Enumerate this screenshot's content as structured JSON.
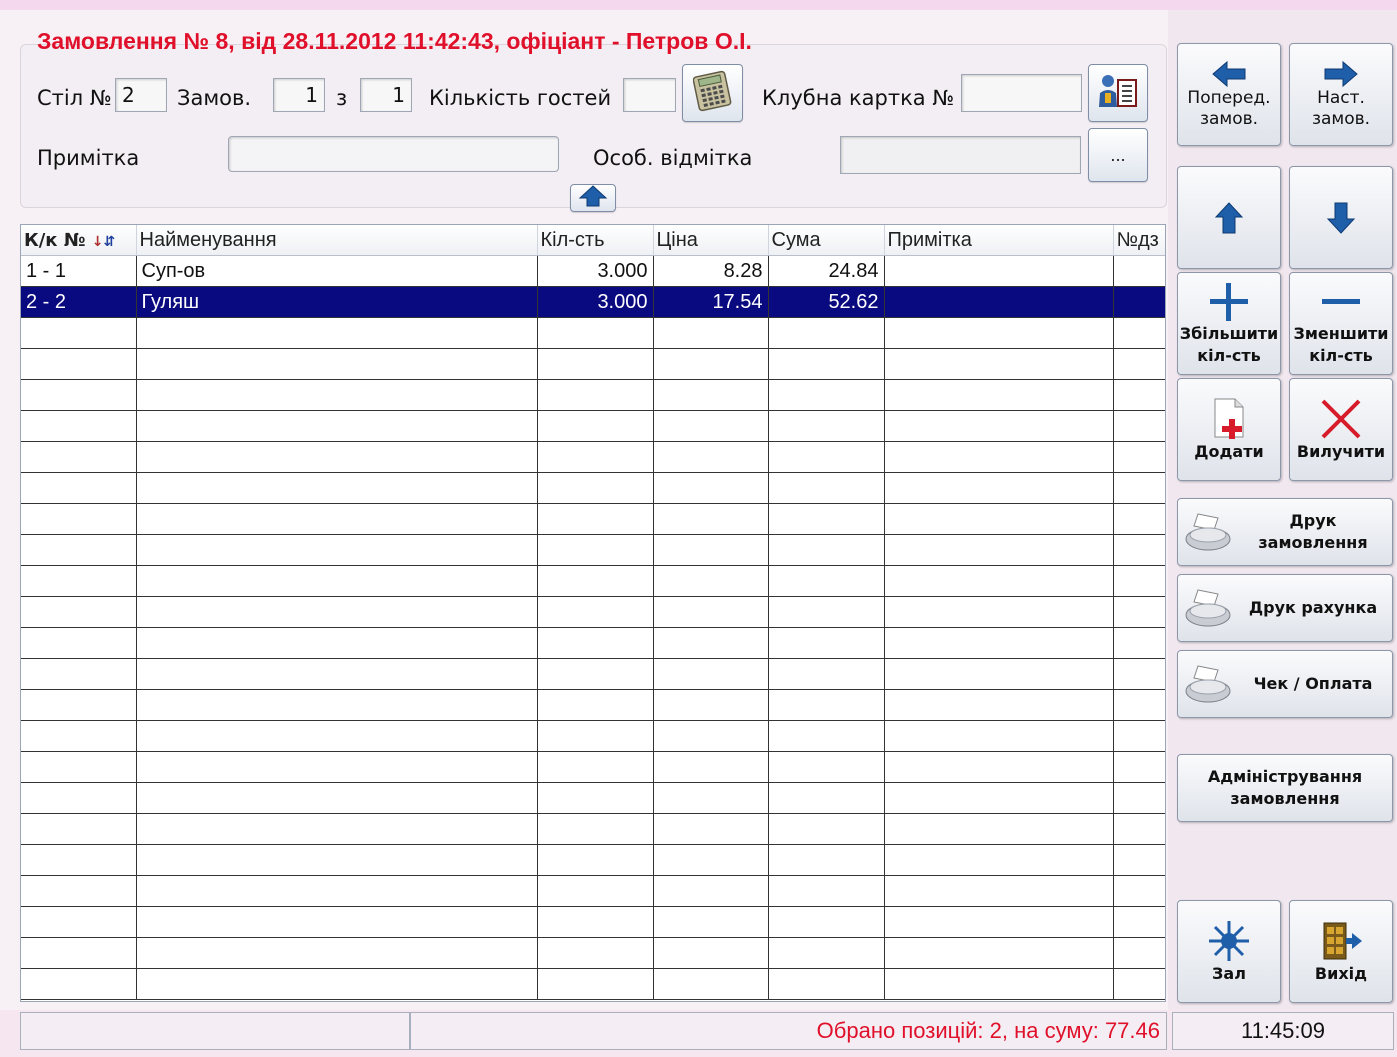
{
  "title": "Замовлення № 8, від 28.11.2012 11:42:43, офіціант - Петров О.І.",
  "header": {
    "table_label": "Стіл №",
    "table_value": "2",
    "order_label": "Замов.",
    "order_current": "1",
    "of_label": "з",
    "order_total": "1",
    "guests_label": "Кількість гостей",
    "guests_value": "",
    "club_card_label": "Клубна картка №",
    "club_card_value": "",
    "note_label": "Примітка",
    "note_value": "",
    "special_label": "Особ. відмітка",
    "special_value": "",
    "more_label": "..."
  },
  "grid": {
    "columns": [
      "К/к №",
      "Найменування",
      "Кіл-сть",
      "Ціна",
      "Сума",
      "Примітка",
      "№дз"
    ],
    "rows": [
      [
        "1 - 1",
        "Суп-ов",
        "3.000",
        "8.28",
        "24.84",
        "",
        ""
      ],
      [
        "2 - 2",
        "Гуляш",
        "3.000",
        "17.54",
        "52.62",
        "",
        ""
      ]
    ],
    "selected_row": 1,
    "empty_rows": 22
  },
  "status": {
    "left": "",
    "summary": "Обрано позицій: 2, на суму: 77.46",
    "time": "11:45:09"
  },
  "buttons": {
    "prev_order": "Поперед.\nзамов.",
    "next_order": "Наст.\nзамов.",
    "increase": "Збільшити\nкіл-сть",
    "decrease": "Зменшити\nкіл-сть",
    "add": "Додати",
    "remove": "Вилучити",
    "print_order": "Друк\nзамовлення",
    "print_bill": "Друк рахунка",
    "receipt_pay": "Чек / Оплата",
    "admin_order": "Адміністрування\nзамовлення",
    "hall": "Зал",
    "exit": "Вихід"
  },
  "colors": {
    "title_red": "#e0102a",
    "selection_navy": "#0a0a80",
    "arrow_blue": "#1f5ea8"
  },
  "icons": [
    "left-arrow-icon",
    "right-arrow-icon",
    "up-arrow-icon",
    "down-arrow-icon",
    "plus-icon",
    "minus-icon",
    "add-document-icon",
    "delete-x-icon",
    "printer-icon",
    "hall-icon",
    "exit-door-icon",
    "calculator-icon",
    "club-card-icon",
    "collapse-up-icon",
    "sort-icon"
  ]
}
